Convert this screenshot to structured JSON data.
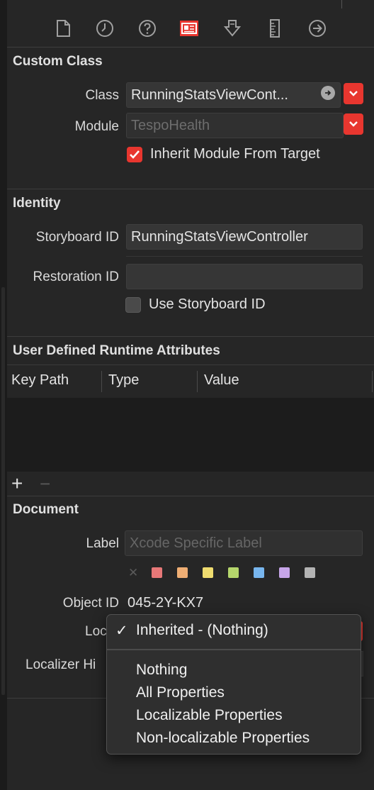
{
  "custom_class": {
    "title": "Custom Class",
    "class_label": "Class",
    "class_value": "RunningStatsViewCont...",
    "module_label": "Module",
    "module_placeholder": "TespoHealth",
    "inherit_label": "Inherit Module From Target",
    "inherit_checked": true
  },
  "identity": {
    "title": "Identity",
    "storyboard_id_label": "Storyboard ID",
    "storyboard_id_value": "RunningStatsViewController",
    "restoration_id_label": "Restoration ID",
    "restoration_id_value": "",
    "use_storyboard_label": "Use Storyboard ID",
    "use_storyboard_checked": false
  },
  "runtime_attributes": {
    "title": "User Defined Runtime Attributes",
    "columns": [
      "Key Path",
      "Type",
      "Value"
    ],
    "add_symbol": "+",
    "remove_symbol": "−"
  },
  "document": {
    "title": "Document",
    "label_label": "Label",
    "label_placeholder": "Xcode Specific Label",
    "clear_symbol": "✕",
    "swatch_colors": [
      "#e77878",
      "#efae74",
      "#efdc6f",
      "#b5d66c",
      "#78b6ee",
      "#c6a5e8",
      "#b3b3b3"
    ],
    "object_id_label": "Object ID",
    "object_id_value": "045-2Y-KX7",
    "localization_label_partial": "Loc",
    "localizer_hint_label_partial": "Localizer Hi"
  },
  "localization_menu": {
    "selected": "Inherited - (Nothing)",
    "check_symbol": "✓",
    "options": [
      "Nothing",
      "All Properties",
      "Localizable Properties",
      "Non-localizable Properties"
    ]
  },
  "toolbar_icons": [
    "file-inspector-icon",
    "history-inspector-icon",
    "quick-help-icon",
    "identity-inspector-icon",
    "attributes-inspector-icon",
    "size-inspector-icon",
    "connections-inspector-icon"
  ],
  "colors": {
    "accent": "#e8362f"
  }
}
